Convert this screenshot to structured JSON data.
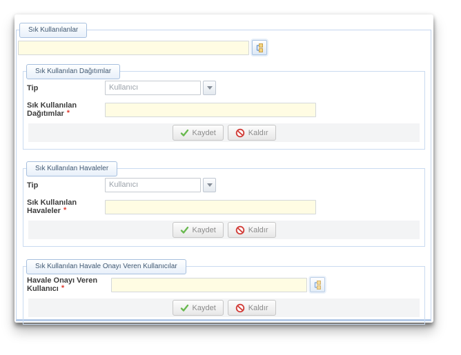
{
  "window": {
    "outer_legend": "Sık Kullanılanlar"
  },
  "favorites": {
    "input_value": ""
  },
  "sections": [
    {
      "legend": "Sık Kullanılan Dağıtımlar",
      "tip_label": "Tip",
      "tip_value": "Kullanıcı",
      "field_label": "Sık Kullanılan Dağıtımlar",
      "required_mark": "*",
      "field_value": "",
      "save_label": "Kaydet",
      "remove_label": "Kaldır"
    },
    {
      "legend": "Sık Kullanılan Havaleler",
      "tip_label": "Tip",
      "tip_value": "Kullanıcı",
      "field_label": "Sık Kullanılan Havaleler",
      "required_mark": "*",
      "field_value": "",
      "save_label": "Kaydet",
      "remove_label": "Kaldır"
    },
    {
      "legend": "Sık Kullanılan Havale Onayı Veren Kullanıcılar",
      "field_label": "Havale Onayı Veren Kullanıcı",
      "required_mark": "*",
      "field_value": "",
      "save_label": "Kaydet",
      "remove_label": "Kaldır"
    }
  ],
  "icons": {
    "lookup": "org-chart-lookup-icon",
    "save": "green-check-icon",
    "remove": "red-prohibition-icon",
    "select_arrow": "chevron-down-icon"
  },
  "colors": {
    "fieldset_border": "#c9daf0",
    "legend_border": "#a6bfde",
    "input_bg": "#fffce3",
    "button_bar_bg": "#f3f4f5",
    "required": "#e03b30",
    "check_green": "#69b94f",
    "prohibition_red": "#d23f3a"
  }
}
